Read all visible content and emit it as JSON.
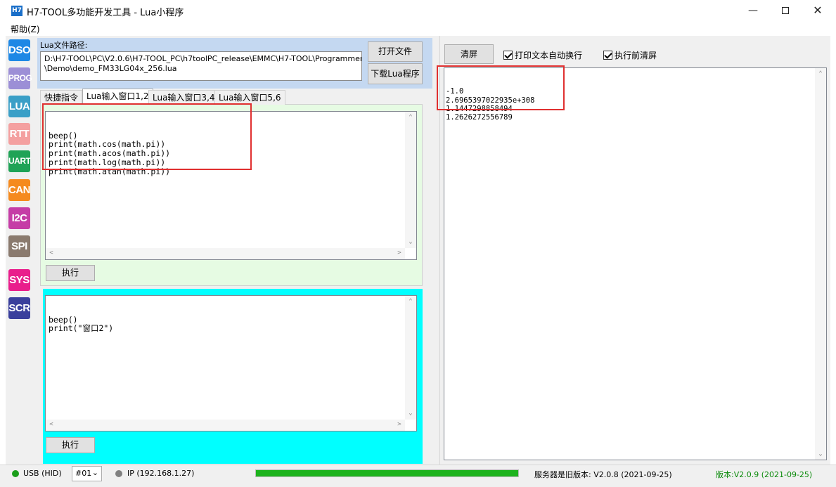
{
  "window": {
    "title": "H7-TOOL多功能开发工具 - Lua小程序",
    "icon_text": "H7"
  },
  "menu": {
    "help": "帮助(Z)"
  },
  "sidebar": {
    "items": [
      {
        "label": "DSO",
        "color": "#1e88e5"
      },
      {
        "label": "PROG",
        "color": "#9c8fd6"
      },
      {
        "label": "LUA",
        "color": "#3a9fc7"
      },
      {
        "label": "RTT",
        "color": "#f4a0a0"
      },
      {
        "label": "UART",
        "color": "#1fa356"
      },
      {
        "label": "CAN",
        "color": "#f58a1e"
      },
      {
        "label": "I2C",
        "color": "#c53da6"
      },
      {
        "label": "SPI",
        "color": "#8a7a6e"
      },
      {
        "label": "SYS",
        "color": "#e91e8c"
      },
      {
        "label": "SCR",
        "color": "#3a3f9c"
      }
    ]
  },
  "lua_path": {
    "label": "Lua文件路径:",
    "line1": "D:\\H7-TOOL\\PC\\V2.0.6\\H7-TOOL_PC\\h7toolPC_release\\EMMC\\H7-TOOL\\Programmer\\User",
    "line2": "\\Demo\\demo_FM33LG04x_256.lua",
    "open_button": "打开文件",
    "download_button": "下载Lua程序"
  },
  "tabs": [
    "快捷指令",
    "Lua输入窗口1,2",
    "Lua输入窗口3,4",
    "Lua输入窗口5,6"
  ],
  "editor1": {
    "code": "beep()\nprint(math.cos(math.pi))\nprint(math.acos(math.pi))\nprint(math.log(math.pi))\nprint(math.atan(math.pi))",
    "exec_button": "执行"
  },
  "editor2": {
    "code": "beep()\nprint(\"窗口2\")",
    "exec_button": "执行"
  },
  "right": {
    "clear_button": "清屏",
    "auto_wrap": {
      "label": "打印文本自动换行",
      "checked": true
    },
    "clear_before": {
      "label": "执行前清屏",
      "checked": true
    },
    "output": "-1.0\n2.6965397022935e+308\n1.1447298858494\n1.2626272556789"
  },
  "status": {
    "usb": "USB (HID)",
    "device": "#01",
    "ip": "IP (192.168.1.27)",
    "progress": 1.0,
    "server_version": "服务器是旧版本: V2.0.8 (2021-09-25)",
    "version": "版本:V2.0.9 (2021-09-25)"
  },
  "colors": {
    "progress": "#1db31d",
    "version_text": "#0a8a0a",
    "highlight": "#e03030"
  }
}
